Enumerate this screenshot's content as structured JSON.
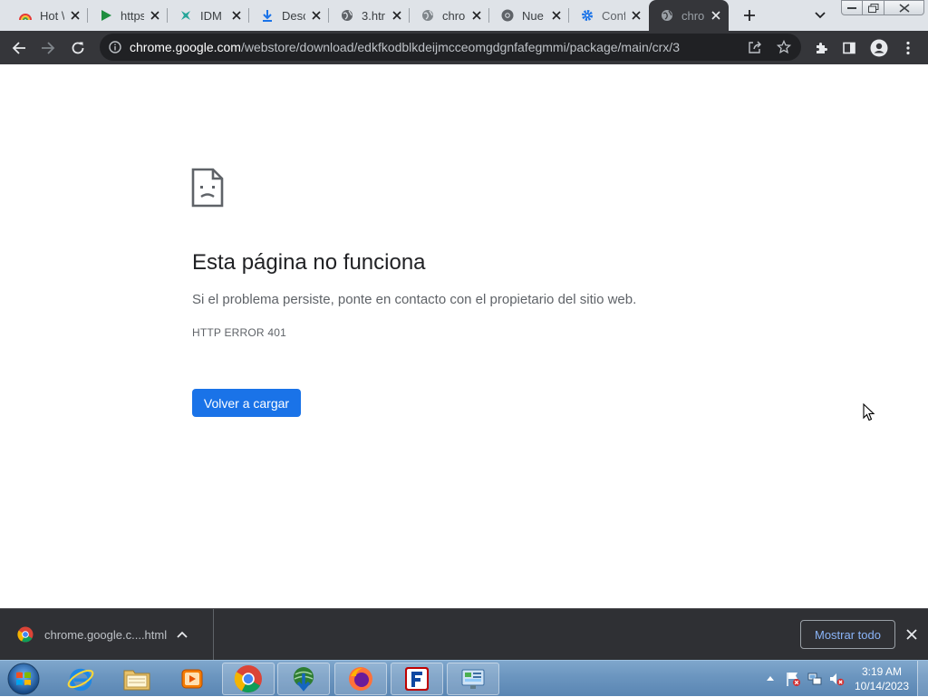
{
  "browser": {
    "tabs": [
      {
        "label": "Hot \\",
        "icon": "rainbow-icon",
        "active": false
      },
      {
        "label": "https",
        "icon": "play-icon",
        "active": false
      },
      {
        "label": "IDM",
        "icon": "puzzle-icon",
        "active": false
      },
      {
        "label": "Desc",
        "icon": "download-icon",
        "active": false
      },
      {
        "label": "3.htr",
        "icon": "globe-icon",
        "active": false
      },
      {
        "label": "chro",
        "icon": "globe-icon",
        "active": false
      },
      {
        "label": "Nue",
        "icon": "chrome-icon",
        "active": false
      },
      {
        "label": "Conf",
        "icon": "gear-icon",
        "active": false
      },
      {
        "label": "chro",
        "icon": "globe-icon",
        "active": true
      }
    ],
    "omnibox": {
      "host": "chrome.google.com",
      "path": "/webstore/download/edkfkodblkdeijmcceomgdgnfafegmmi/package/main/crx/3"
    }
  },
  "error_page": {
    "title": "Esta página no funciona",
    "description": "Si el problema persiste, ponte en contacto con el propietario del sitio web.",
    "code": "HTTP ERROR 401",
    "reload_label": "Volver a cargar"
  },
  "download_shelf": {
    "item_name": "chrome.google.c....html",
    "show_all_label": "Mostrar todo"
  },
  "taskbar": {
    "apps": [
      "internet-explorer",
      "file-explorer",
      "media-player",
      "chrome",
      "internet-download-manager",
      "firefox",
      "filezilla",
      "control-panel"
    ],
    "time": "3:19 AM",
    "date": "10/14/2023"
  },
  "colors": {
    "accent": "#1a73e8",
    "toolbar": "#35363a",
    "tabstrip": "#dfe3e8",
    "shelf": "#2f3034"
  }
}
